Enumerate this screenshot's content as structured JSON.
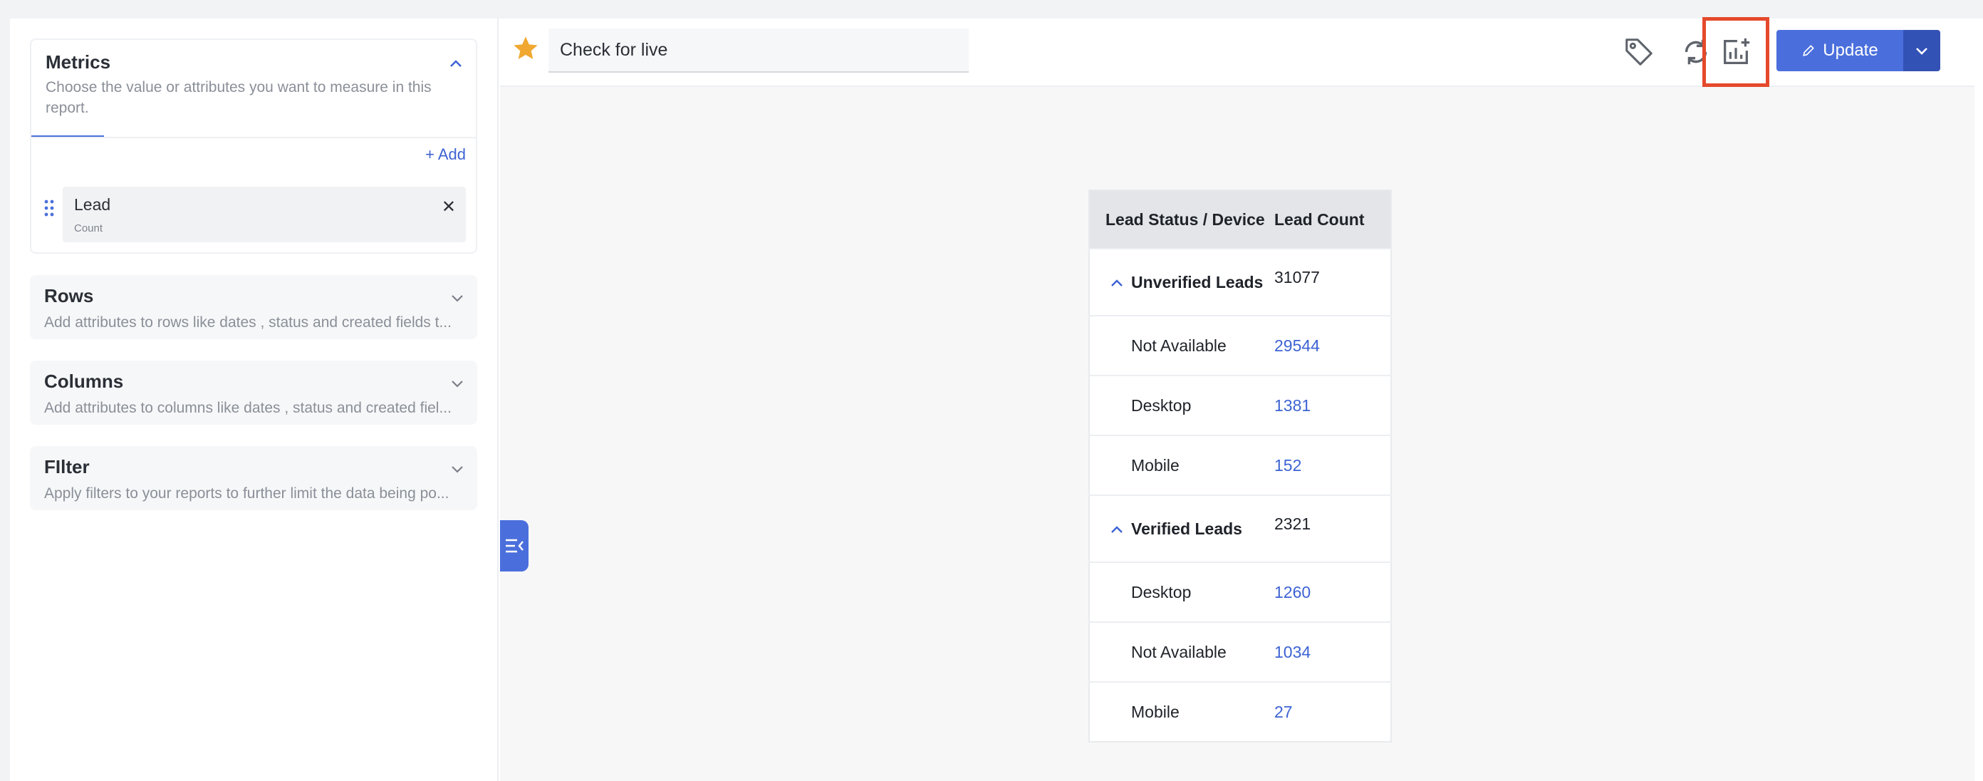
{
  "sidebar": {
    "metrics": {
      "title": "Metrics",
      "description": "Choose the value or attributes you want to measure in this report.",
      "add_label": "+ Add",
      "item": {
        "name": "Lead",
        "sub": "Count"
      }
    },
    "rows": {
      "title": "Rows",
      "description": "Add attributes to rows like dates , status and created fields t..."
    },
    "columns": {
      "title": "Columns",
      "description": "Add attributes to columns like dates , status and created fiel..."
    },
    "filter": {
      "title": "FIlter",
      "description": "Apply filters to your reports to further limit the data being po..."
    }
  },
  "toolbar": {
    "report_name": "Check for live",
    "update_label": "Update",
    "accent_color": "#4a6fdc",
    "highlight_color": "#e4492b"
  },
  "table": {
    "headers": [
      "Lead Status / Device",
      "Lead Count"
    ],
    "groups": [
      {
        "label": "Unverified Leads",
        "total": "31077",
        "rows": [
          {
            "label": "Not Available",
            "value": "29544"
          },
          {
            "label": "Desktop",
            "value": "1381"
          },
          {
            "label": "Mobile",
            "value": "152"
          }
        ]
      },
      {
        "label": "Verified Leads",
        "total": "2321",
        "rows": [
          {
            "label": "Desktop",
            "value": "1260"
          },
          {
            "label": "Not Available",
            "value": "1034"
          },
          {
            "label": "Mobile",
            "value": "27"
          }
        ]
      }
    ]
  }
}
